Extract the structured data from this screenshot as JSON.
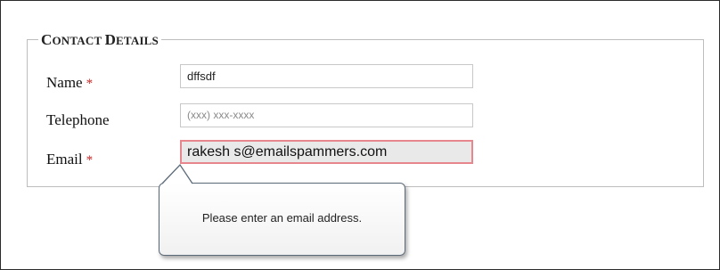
{
  "form": {
    "legend_first": "C",
    "legend_rest_1": "ONTACT ",
    "legend_second": "D",
    "legend_rest_2": "ETAILS",
    "required_marker": "*",
    "fields": {
      "name": {
        "label": "Name",
        "value": "dffsdf",
        "required": true
      },
      "telephone": {
        "label": "Telephone",
        "placeholder": "(xxx) xxx-xxxx",
        "required": false
      },
      "email": {
        "label": "Email",
        "value": "rakesh s@emailspammers.com",
        "required": true,
        "invalid": true
      }
    }
  },
  "validation_tooltip": {
    "message": "Please enter an email address."
  },
  "colors": {
    "required": "#c62828",
    "invalid_border": "#e8868e",
    "invalid_background": "#e9e9e9",
    "tooltip_border": "#5b6a78"
  }
}
